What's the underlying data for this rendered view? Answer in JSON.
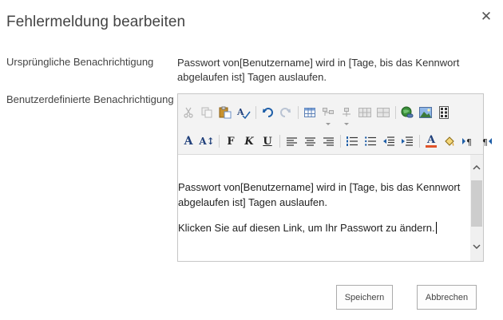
{
  "dialog": {
    "title": "Fehlermeldung bearbeiten",
    "close_glyph": "✕"
  },
  "fields": {
    "original_label": "Ursprüngliche Benachrichtigung",
    "original_text": "Passwort von[Benutzername] wird in [Tage, bis das Kennwort abgelaufen ist] Tagen auslaufen.",
    "custom_label": "Benutzerdefinierte Benachrichtigung"
  },
  "toolbar": {
    "row1": [
      "cut-icon",
      "copy-icon",
      "paste-icon",
      "spellcheck-icon",
      "undo-icon",
      "redo-icon",
      "insert-table-icon",
      "table-layout-icon",
      "table-structure-icon",
      "table-merge-icon",
      "table-split-icon",
      "insert-link-icon",
      "insert-image-icon",
      "insert-symbol-icon"
    ],
    "row2_glyphs": {
      "font": "A",
      "font_size": "A↕",
      "bold": "F",
      "italic": "K",
      "underline": "U",
      "font_color": "A"
    },
    "font_color": "#e0532a"
  },
  "editor": {
    "paragraph1": "Passwort von[Benutzername] wird in [Tage, bis das Kennwort abgelaufen ist] Tagen auslaufen.",
    "paragraph2": "Klicken Sie auf diesen Link, um Ihr Passwort zu ändern."
  },
  "buttons": {
    "save": "Speichern",
    "cancel": "Abbrechen"
  },
  "colors": {
    "text": "#444444",
    "toolbar_bg": "#f3f3f3",
    "icon_blue": "#1f5fa8"
  }
}
